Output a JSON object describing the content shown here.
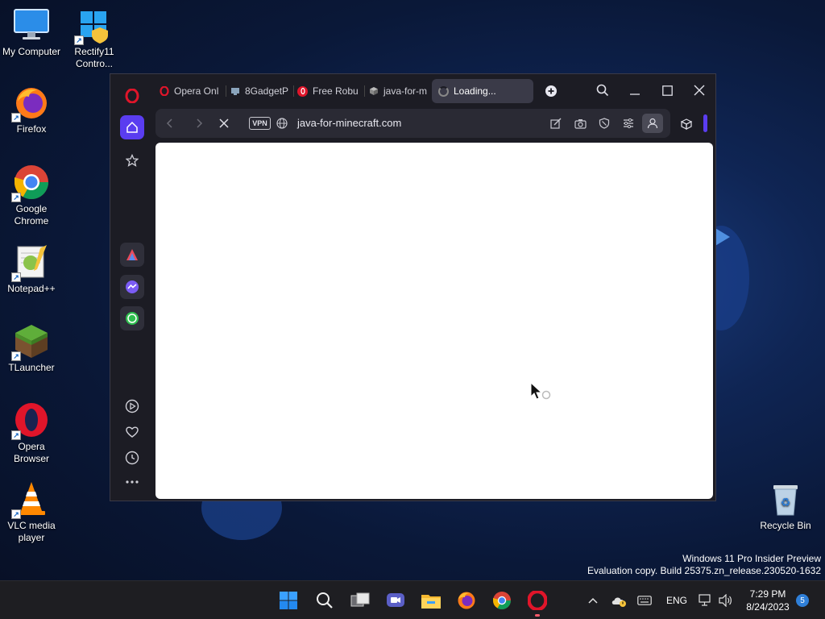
{
  "desktop": {
    "icons": [
      {
        "label": "My Computer"
      },
      {
        "label": "Rectify11 Contro..."
      },
      {
        "label": "Firefox"
      },
      {
        "label": "Google Chrome"
      },
      {
        "label": "Notepad++"
      },
      {
        "label": "TLauncher"
      },
      {
        "label": "Opera Browser"
      },
      {
        "label": "VLC media player"
      },
      {
        "label": "Recycle Bin"
      }
    ],
    "watermark": {
      "line1": "Windows 11 Pro Insider Preview",
      "line2": "Evaluation copy. Build 25375.zn_release.230520-1632"
    }
  },
  "browser": {
    "tabs": [
      {
        "label": "Opera Onl",
        "icon": "opera-icon"
      },
      {
        "label": "8GadgetP",
        "icon": "monitor-icon"
      },
      {
        "label": "Free Robu",
        "icon": "opera-red-icon"
      },
      {
        "label": "java-for-m",
        "icon": "cube-icon"
      },
      {
        "label": "Loading...",
        "icon": "spinner-icon",
        "active": true
      }
    ],
    "address": {
      "vpn_label": "VPN",
      "url": "java-for-minecraft.com"
    },
    "accent": "#5a3df0"
  },
  "taskbar": {
    "language": "ENG",
    "time": "7:29 PM",
    "date": "8/24/2023",
    "notification_count": "5"
  }
}
